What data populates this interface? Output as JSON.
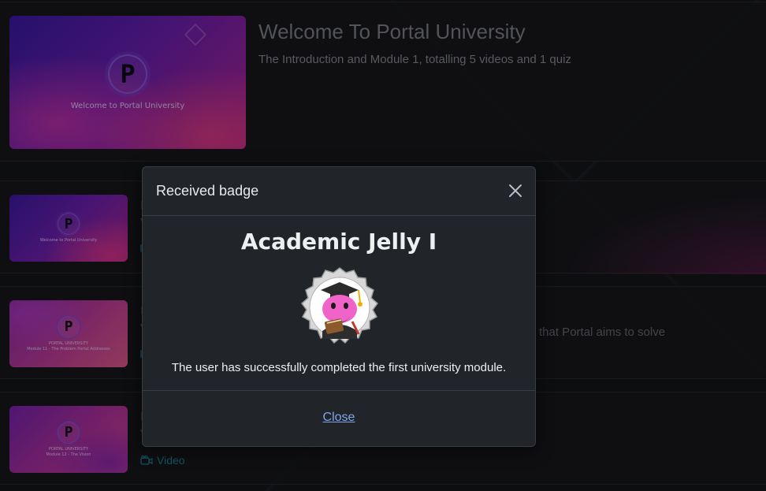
{
  "course": {
    "hero": {
      "title": "Welcome To Portal University",
      "subtitle": "The Introduction and Module 1, totalling 5 videos and 1 quiz",
      "thumb_logo": "P",
      "thumb_caption": "Welcome to Portal University"
    },
    "lessons": [
      {
        "thumb_logo": "P",
        "thumb_caption": "Welcome to Portal University",
        "title_fragment": "I",
        "sub_fragment": "V"
      },
      {
        "thumb_logo": "P",
        "thumb_caption": "PORTAL UNIVERSITY\nModule 11 - The Problem Portal Addresses",
        "title_fragment": "I",
        "sub_fragment": "V",
        "desc_tail": "that Portal aims to solve"
      },
      {
        "thumb_logo": "P",
        "thumb_caption": "PORTAL UNIVERSITY\nModule 12 - The Vision",
        "title_fragment": "I",
        "sub_fragment": "V",
        "type_label": "Video",
        "type_icon": "video-camera-icon"
      }
    ]
  },
  "modal": {
    "title": "Received badge",
    "close_icon": "close-icon",
    "badge_name": "Academic Jelly I",
    "badge_image": "academic-jelly-badge-icon",
    "description": "The user has successfully completed the first university module.",
    "close_label": "Close"
  },
  "colors": {
    "link": "#7fa6ea",
    "video_link": "#1f7f96",
    "modal_bg": "#212428"
  }
}
